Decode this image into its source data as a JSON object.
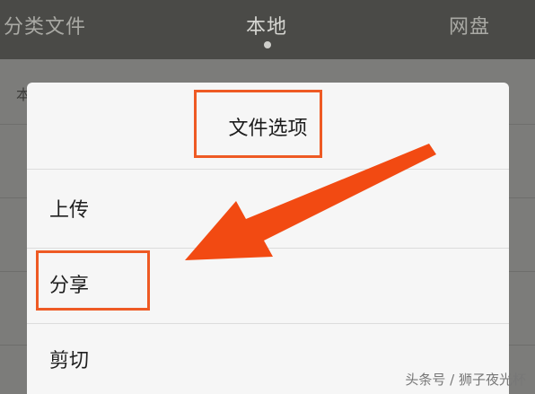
{
  "tabs": [
    {
      "label": "分类文件"
    },
    {
      "label": "本地"
    },
    {
      "label": "网盘"
    }
  ],
  "background_list": {
    "first_item_label": "本"
  },
  "dialog": {
    "title": "文件选项",
    "items": [
      {
        "label": "上传"
      },
      {
        "label": "分享"
      },
      {
        "label": "剪切"
      }
    ]
  },
  "highlight_color": "#ee5a24",
  "arrow": {
    "color": "#f24a12",
    "icon": "arrow-icon"
  },
  "watermark": "头条号 / 狮子夜光杯"
}
